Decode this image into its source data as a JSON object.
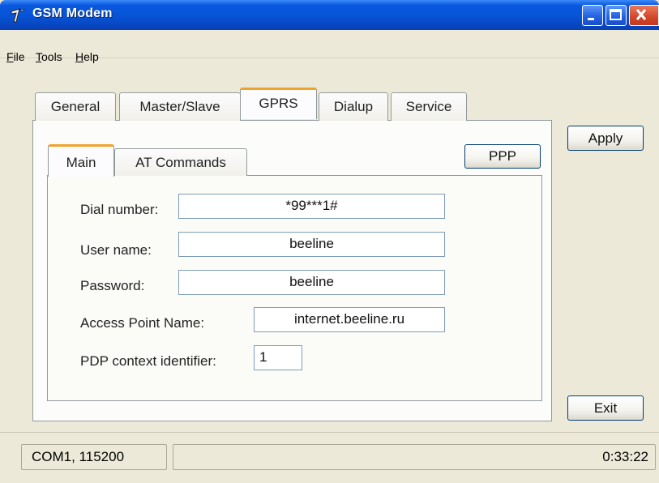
{
  "window": {
    "title": "GSM Modem"
  },
  "menu": [
    {
      "label": "File",
      "key": "F",
      "rest": "ile"
    },
    {
      "label": "Tools",
      "key": "T",
      "rest": "ools"
    },
    {
      "label": "Help",
      "key": "H",
      "rest": "elp"
    }
  ],
  "tabs": [
    "General",
    "Master/Slave",
    "GPRS",
    "Dialup",
    "Service"
  ],
  "active_tab": "GPRS",
  "subtabs": [
    "Main",
    "AT Commands"
  ],
  "active_subtab": "Main",
  "buttons": {
    "ppp": "PPP",
    "apply": "Apply",
    "exit": "Exit"
  },
  "form": {
    "dial_number_label": "Dial number:",
    "dial_number_value": "*99***1#",
    "user_name_label": "User name:",
    "user_name_value": "beeline",
    "password_label": "Password:",
    "password_value": "beeline",
    "apn_label": "Access Point Name:",
    "apn_value": "internet.beeline.ru",
    "pdp_label": "PDP context identifier:",
    "pdp_value": "1"
  },
  "status": {
    "port": "COM1, 115200",
    "time": "0:33:22"
  },
  "colors": {
    "titlebar": "#0653d6",
    "tab_highlight": "#f0a32b",
    "window_bg": "#ece9d8"
  },
  "icons": {
    "app": "modem-icon",
    "minimize": "minimize-icon",
    "maximize": "maximize-icon",
    "close": "close-icon"
  }
}
